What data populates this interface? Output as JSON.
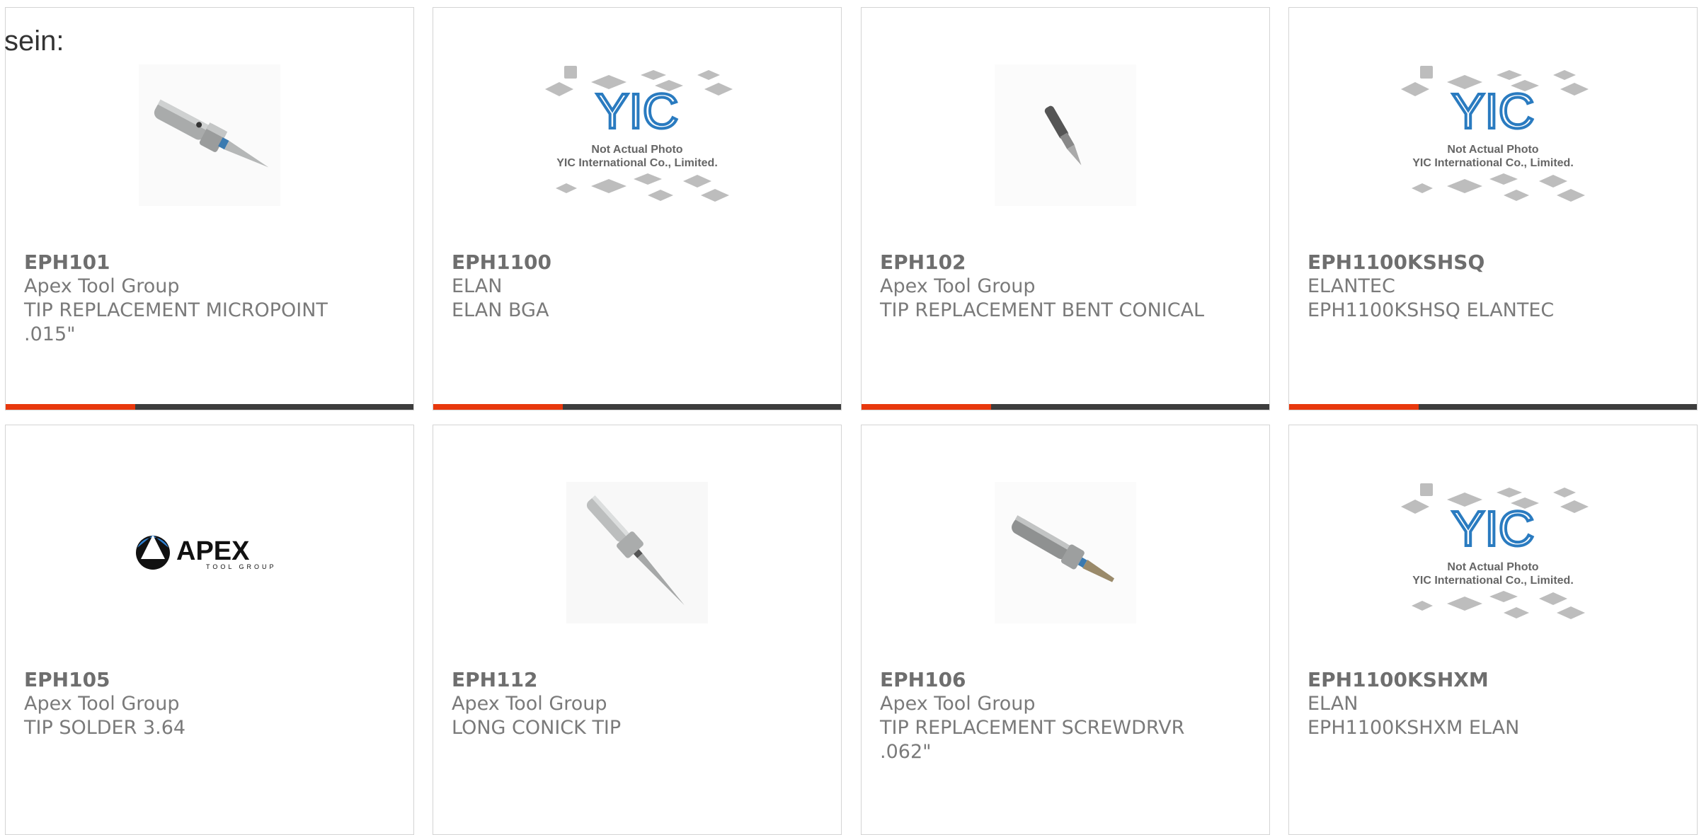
{
  "lead_text": "sein:",
  "colors": {
    "accent": "#e8380d",
    "bar": "#3d3d3d",
    "border": "#d4d4d4",
    "text": "#7a7a7a"
  },
  "placeholder_image": {
    "line1": "Not Actual Photo",
    "line2": "YIC International Co., Limited."
  },
  "apex_logo": {
    "brand": "APEX",
    "sub": "TOOL GROUP"
  },
  "products": [
    {
      "part": "EPH101",
      "maker": "Apex Tool Group",
      "desc": "TIP REPLACEMENT MICROPOINT .015\"",
      "image": "soldering-tip-photo"
    },
    {
      "part": "EPH1100",
      "maker": "ELAN",
      "desc": "ELAN BGA",
      "image": "yic-placeholder"
    },
    {
      "part": "EPH102",
      "maker": "Apex Tool Group",
      "desc": "TIP REPLACEMENT BENT CONICAL",
      "image": "bent-tip-photo"
    },
    {
      "part": "EPH1100KSHSQ",
      "maker": "ELANTEC",
      "desc": "EPH1100KSHSQ ELANTEC",
      "image": "yic-placeholder"
    },
    {
      "part": "EPH105",
      "maker": "Apex Tool Group",
      "desc": "TIP SOLDER 3.64",
      "image": "apex-logo"
    },
    {
      "part": "EPH112",
      "maker": "Apex Tool Group",
      "desc": "LONG CONICK TIP",
      "image": "long-tip-photo"
    },
    {
      "part": "EPH106",
      "maker": "Apex Tool Group",
      "desc": "TIP REPLACEMENT SCREWDRVR .062\"",
      "image": "screwdriver-tip-photo"
    },
    {
      "part": "EPH1100KSHXM",
      "maker": "ELAN",
      "desc": "EPH1100KSHXM ELAN",
      "image": "yic-placeholder"
    }
  ]
}
